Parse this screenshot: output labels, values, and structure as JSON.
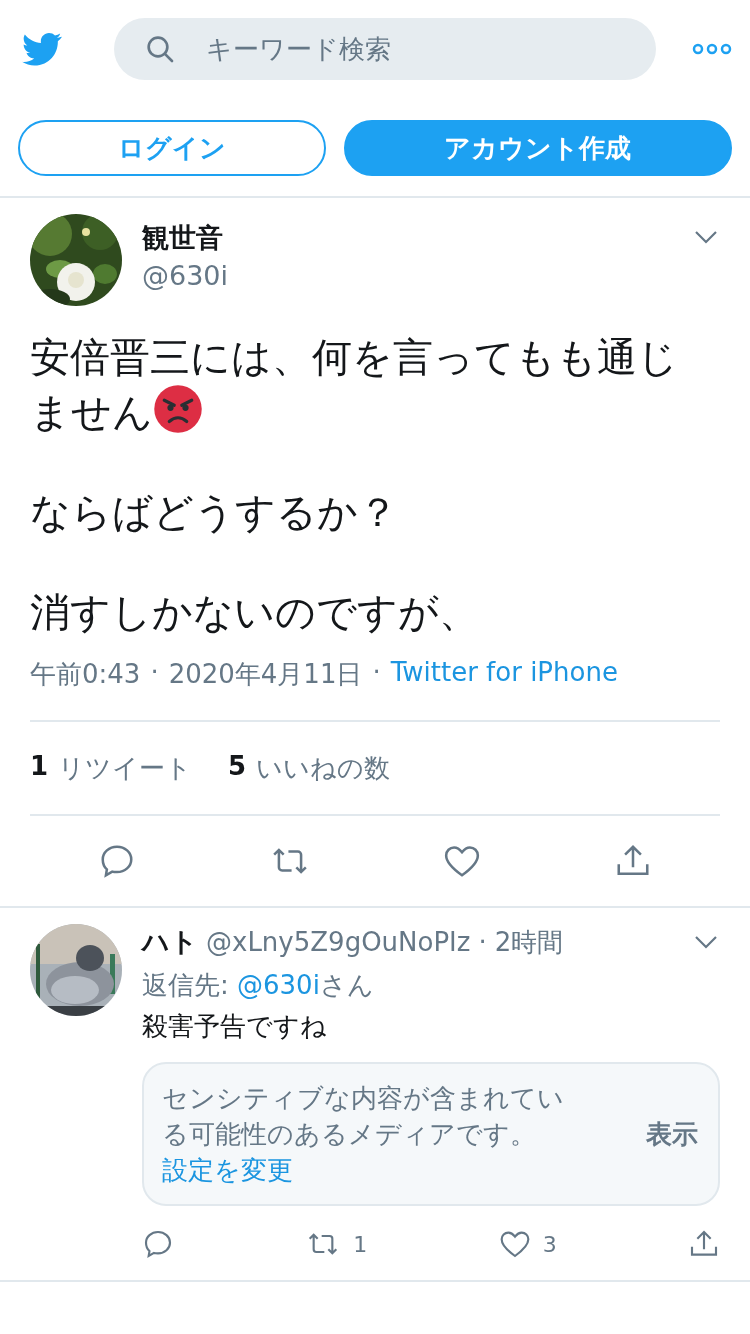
{
  "header": {
    "search": {
      "placeholder": "キーワード検索"
    }
  },
  "auth_buttons": [
    {
      "label": "ログイン",
      "kind": "outline"
    },
    {
      "label": "アカウント作成",
      "kind": "filled"
    }
  ],
  "tweet": {
    "name": "観世音",
    "handle": "@630i",
    "paragraphs": [
      {
        "lines": [
          "安倍晋三には、何を言ってもも通じ",
          "ません"
        ],
        "emoji": true
      },
      {
        "lines": [
          "ならばどうするか？"
        ],
        "emoji": false
      },
      {
        "lines": [
          "消すしかないのですが、"
        ],
        "emoji": false
      }
    ],
    "time": "午前0:43",
    "separators": [
      "·",
      "·"
    ],
    "date": "2020年4月11日",
    "source": "Twitter for iPhone",
    "stats": [
      {
        "count": "1",
        "label": "リツイート"
      },
      {
        "count": "5",
        "label": "いいねの数"
      }
    ]
  },
  "replies": [
    {
      "name": "ハト",
      "handle": "@xLny5Z9gOuNoPIz",
      "separator": "·",
      "time": "2時間",
      "reply_prefix": "返信先: ",
      "reply_to": "@630i",
      "reply_suffix": "さん",
      "text": "殺害予告ですね",
      "notice": {
        "text": "センシティブな内容が含まれている可能性のあるメディアです。",
        "link": "設定を変更",
        "button": "表示"
      },
      "retweets": "1",
      "likes": "3"
    }
  ]
}
